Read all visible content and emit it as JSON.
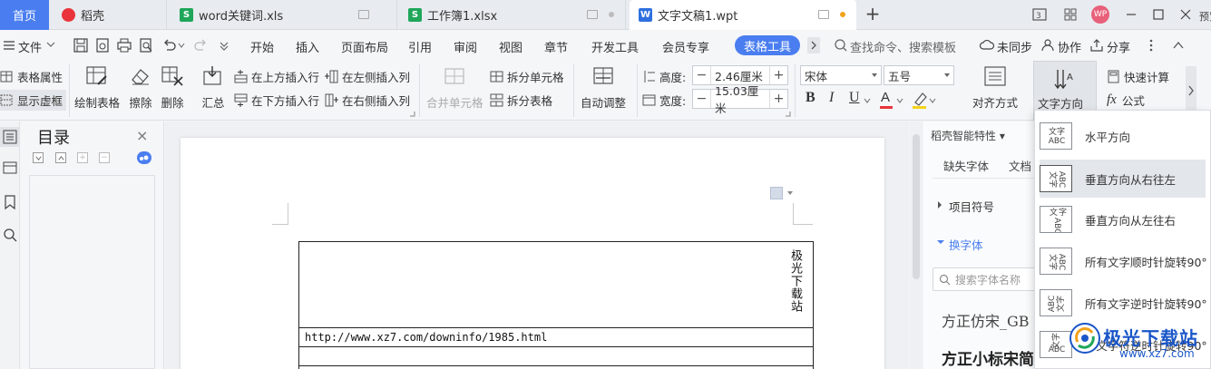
{
  "tabs": {
    "home": "首页",
    "daoke": "稻壳",
    "xls1": "word关键词.xls",
    "xls2": "工作簿1.xlsx",
    "doc": "文字文稿1.wpt",
    "add": "+",
    "avatar_text": "WP",
    "overflow_text": "预览"
  },
  "menu": {
    "file": "文件",
    "items": [
      "开始",
      "插入",
      "页面布局",
      "引用",
      "审阅",
      "视图",
      "章节",
      "开发工具",
      "会员专享"
    ],
    "active": "表格工具",
    "search_placeholder": "查找命令、搜索模板",
    "sync": "未同步",
    "collab": "协作",
    "share": "分享"
  },
  "ribbon": {
    "table_props": "表格属性",
    "show_grid": "显示虚框",
    "draw_table": "绘制表格",
    "erase": "擦除",
    "delete": "删除",
    "summary": "汇总",
    "insert_above": "在上方插入行",
    "insert_below": "在下方插入行",
    "insert_left": "在左侧插入列",
    "insert_right": "在右侧插入列",
    "merge_cells": "合并单元格",
    "split_cells": "拆分单元格",
    "split_table": "拆分表格",
    "auto_fit": "自动调整",
    "height_label": "高度:",
    "height_value": "2.46厘米",
    "width_label": "宽度:",
    "width_value": "15.03厘米",
    "font_name": "宋体",
    "font_size": "五号",
    "bold": "B",
    "italic": "I",
    "underline": "U",
    "font_color_glyph": "A",
    "align": "对齐方式",
    "text_direction": "文字方向",
    "quick_calc": "快速计算",
    "formula": "公式",
    "fx": "fx"
  },
  "toc": {
    "title": "目录",
    "close": "×",
    "btn_collapse": "−",
    "btn_expand": "+"
  },
  "doc": {
    "header_vertical_text": "极光下载站",
    "url_text": "http://www.xz7.com/downinfo/1985.html"
  },
  "right_panel": {
    "title": "稻壳智能特性",
    "tab1": "缺失字体",
    "tab2": "文档",
    "bullet": "项目符号",
    "change_font": "换字体",
    "search_placeholder": "搜索字体名称",
    "font1": "方正仿宋_GB",
    "font2": "方正小标宋简"
  },
  "dropdown": {
    "items": [
      {
        "label": "水平方向",
        "icon": "horizontal-text-icon",
        "glyph": "文字 ABC",
        "selected": false
      },
      {
        "label": "垂直方向从右往左",
        "icon": "vertical-rtl-icon",
        "glyph": "ABC 文字",
        "selected": true
      },
      {
        "label": "垂直方向从左往右",
        "icon": "vertical-ltr-icon",
        "glyph": "文字 ABC",
        "selected": false
      },
      {
        "label": "所有文字顺时针旋转90°",
        "icon": "rotate-cw-icon",
        "glyph": "ABC 文字",
        "selected": false
      },
      {
        "label": "所有文字逆时针旋转90°",
        "icon": "rotate-ccw-icon",
        "glyph": "ABC 文字",
        "selected": false
      },
      {
        "label": "中文字符逆时针旋转90°",
        "icon": "cjk-rotate-icon",
        "glyph": "文字 ABC",
        "selected": false
      }
    ]
  },
  "watermark": {
    "text": "极光下载站",
    "url": "www.xz7.com"
  },
  "colors": {
    "accent": "#4a7ef0",
    "daoke_red": "#e8343a",
    "sheet_green": "#1fa65a",
    "doc_blue": "#2f6fe0",
    "unsaved_dot": "#f0a21b",
    "avatar_pink": "#e8607a"
  }
}
